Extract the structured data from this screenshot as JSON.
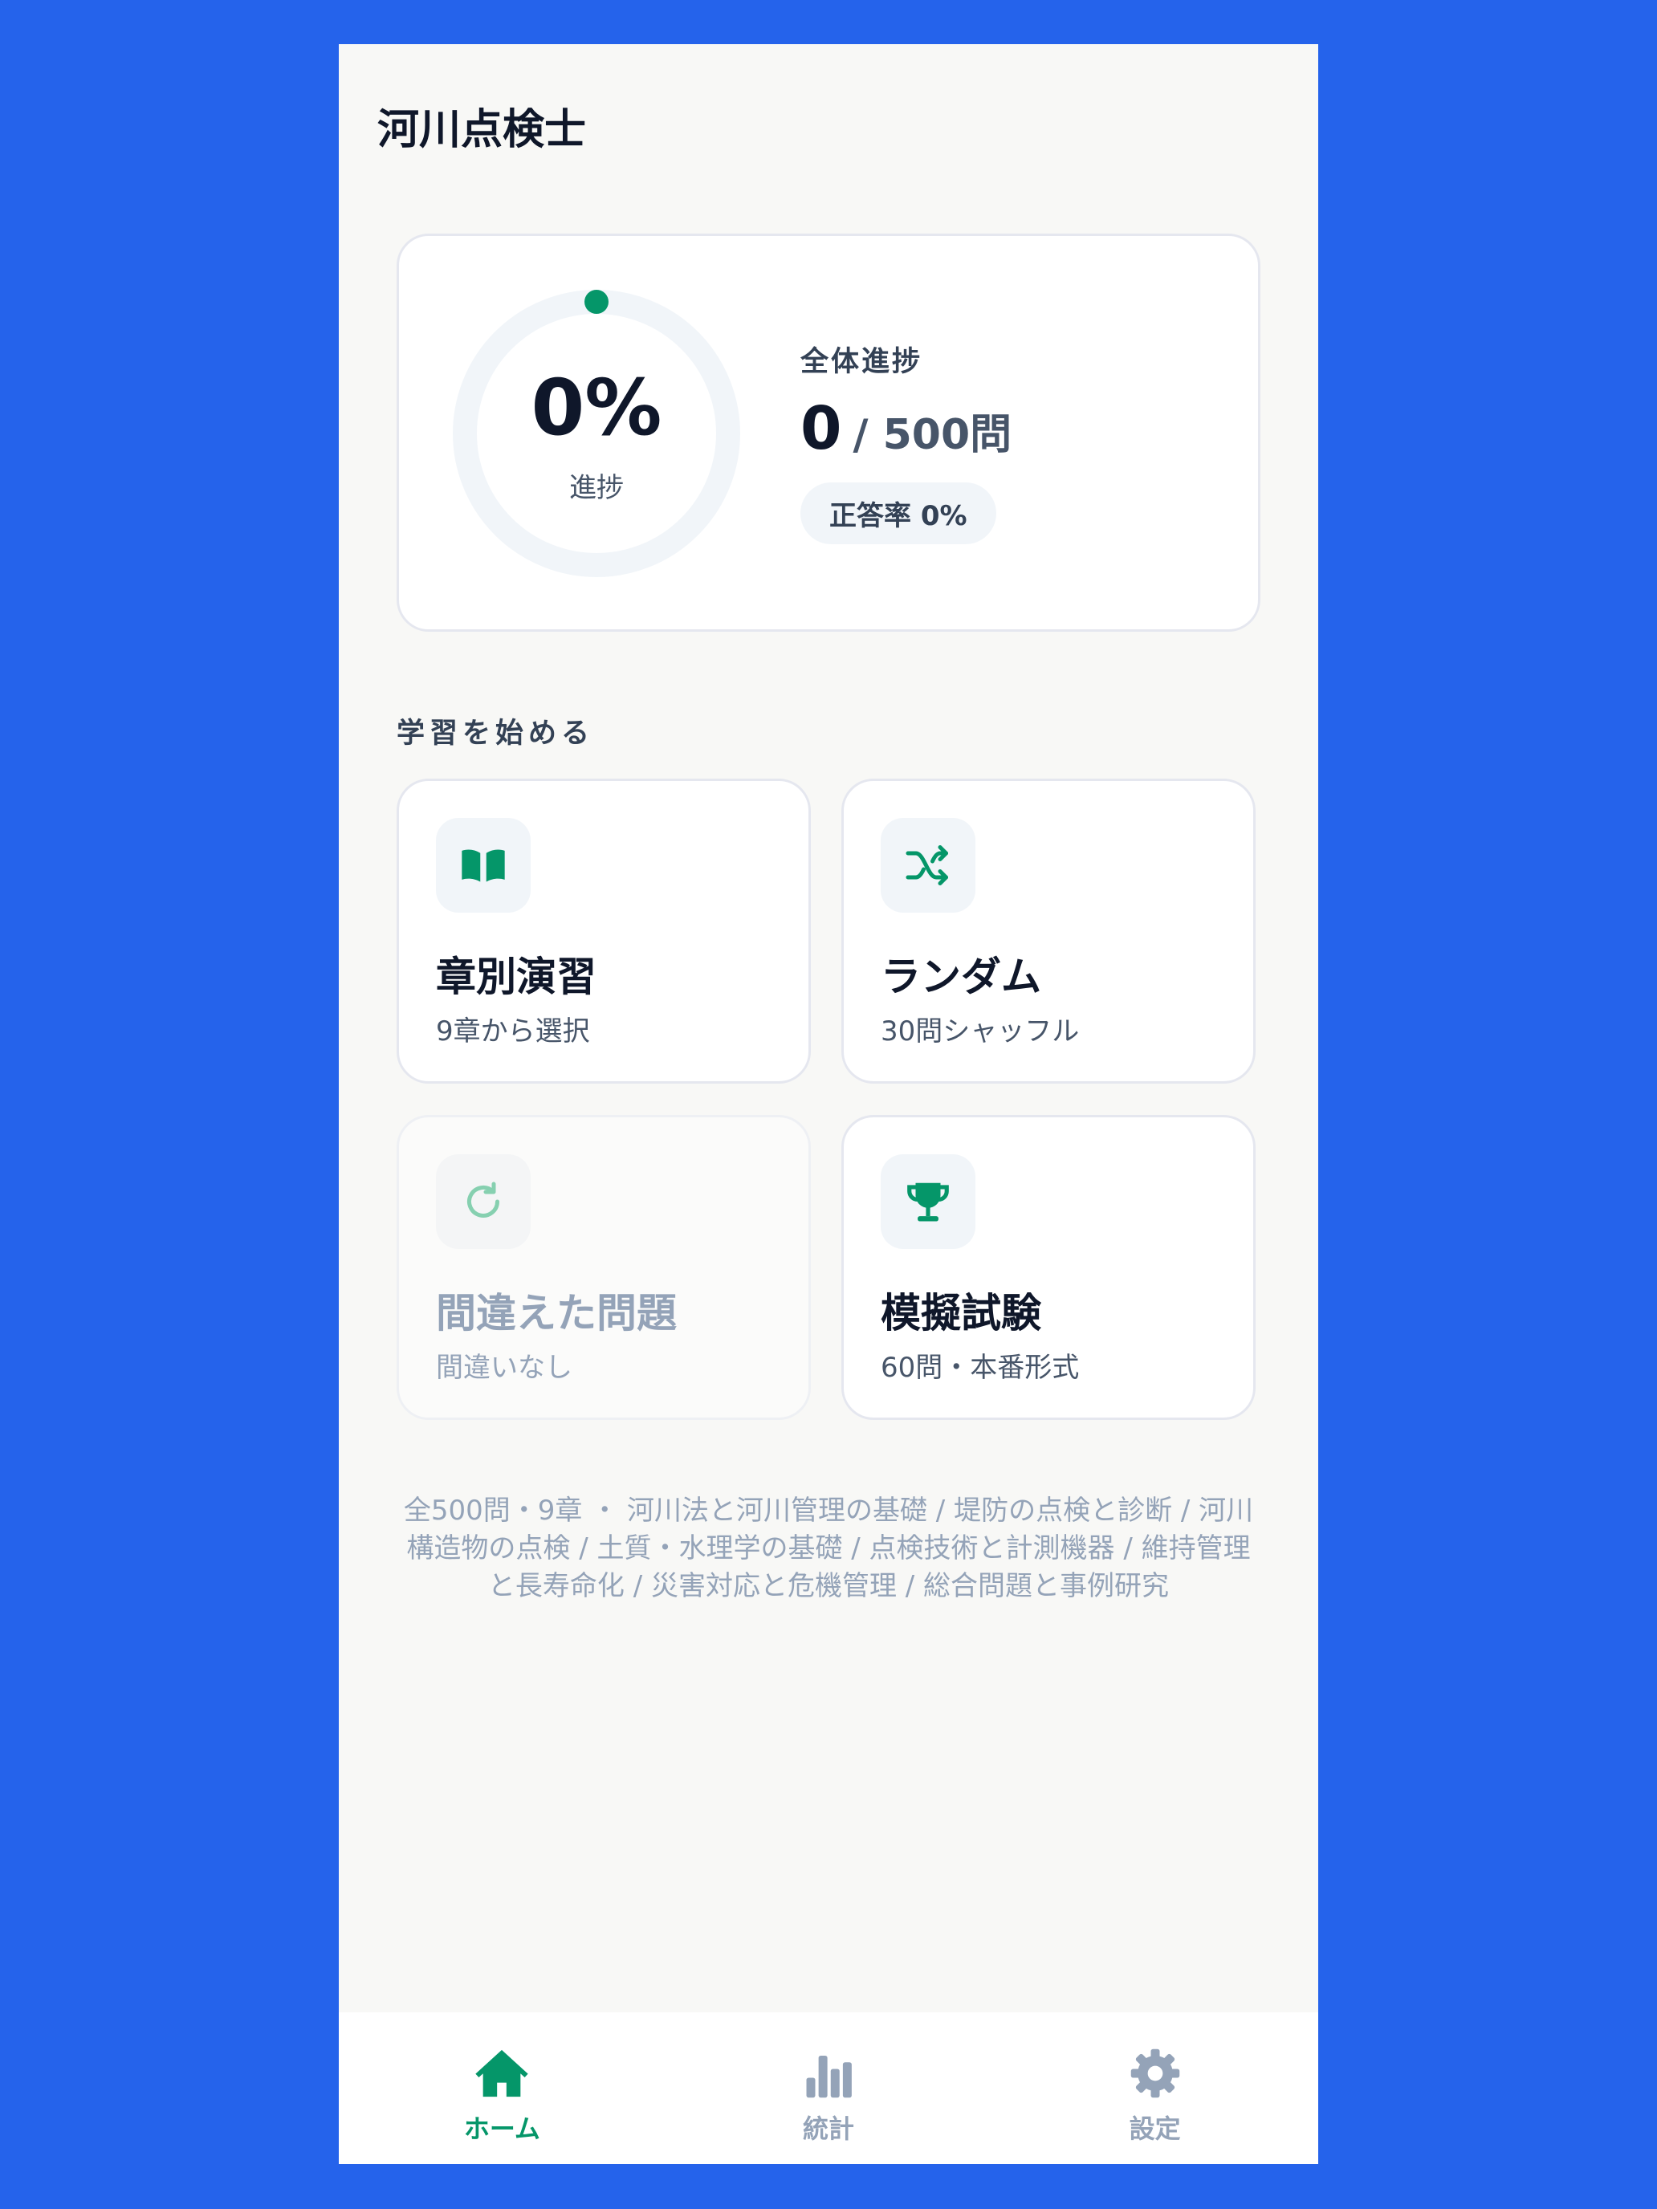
{
  "header": {
    "title": "河川点検士"
  },
  "progress": {
    "percent_text": "0%",
    "percent_value": 0,
    "ring_caption": "進捗",
    "label": "全体進捗",
    "answered": "0",
    "total_text": "/ 500問",
    "accuracy_text": "正答率 0%"
  },
  "colors": {
    "accent": "#059669",
    "background": "#2563eb",
    "ring_track": "#f1f5f9"
  },
  "section": {
    "title": "学習を始める"
  },
  "modes": [
    {
      "title": "章別演習",
      "subtitle": "9章から選択",
      "icon": "book-icon",
      "enabled": true
    },
    {
      "title": "ランダム",
      "subtitle": "30問シャッフル",
      "icon": "shuffle-icon",
      "enabled": true
    },
    {
      "title": "間違えた問題",
      "subtitle": "間違いなし",
      "icon": "retry-icon",
      "enabled": false
    },
    {
      "title": "模擬試験",
      "subtitle": "60問・本番形式",
      "icon": "trophy-icon",
      "enabled": true
    }
  ],
  "footer": {
    "note": "全500問・9章 ・ 河川法と河川管理の基礎 / 堤防の点検と診断 / 河川構造物の点検 / 土質・水理学の基礎 / 点検技術と計測機器 / 維持管理と長寿命化 / 災害対応と危機管理 / 総合問題と事例研究"
  },
  "tabs": [
    {
      "label": "ホーム",
      "icon": "home-icon",
      "active": true
    },
    {
      "label": "統計",
      "icon": "bar-chart-icon",
      "active": false
    },
    {
      "label": "設定",
      "icon": "gear-icon",
      "active": false
    }
  ]
}
